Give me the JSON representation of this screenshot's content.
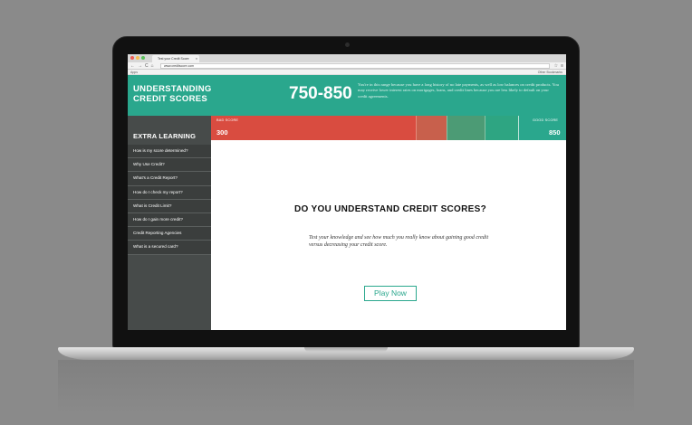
{
  "browser": {
    "tab_title": "Test your Credit Score",
    "tab_close": "×",
    "url": "www.creditscore.com",
    "nav_back": "←",
    "nav_forward": "→",
    "nav_reload": "C",
    "nav_home": "⌂",
    "star": "☆",
    "menu": "≡",
    "bookmark_apps": "Apps",
    "bookmark_other": "Other Bookmarks"
  },
  "header": {
    "brand_line1": "UNDERSTANDING",
    "brand_line2": "CREDIT SCORES",
    "range": "750-850",
    "description": "You're in this range because you have a long history of no late payments, as well as low balances on credit products. You may receive lower interest rates on mortgages, loans, and credit lines because you are less likely to default on your credit agreements."
  },
  "gauge": {
    "bad_label": "BAD SCORE",
    "bad_value": "300",
    "good_label": "GOOD SCORE",
    "good_value": "850",
    "marker_value": "850"
  },
  "sidebar": {
    "title": "EXTRA LEARNING",
    "items": [
      {
        "label": "How is my score determined?"
      },
      {
        "label": "Why Use Credit?"
      },
      {
        "label": "What's a Credit Report?"
      },
      {
        "label": "How do I check my report?"
      },
      {
        "label": "What is Credit Limit?"
      },
      {
        "label": "How do I gain more credit?"
      },
      {
        "label": "Credit Reporting Agencies"
      },
      {
        "label": "What is a secured card?"
      }
    ]
  },
  "main": {
    "title": "DO YOU UNDERSTAND CREDIT SCORES?",
    "text": "Test your knowledge and see how much you really know about gaining good credit versus decreasing your credit score.",
    "play_label": "Play Now"
  },
  "colors": {
    "accent": "#2aa78d",
    "bad": "#d94c40",
    "sidebar": "#474b4a"
  }
}
